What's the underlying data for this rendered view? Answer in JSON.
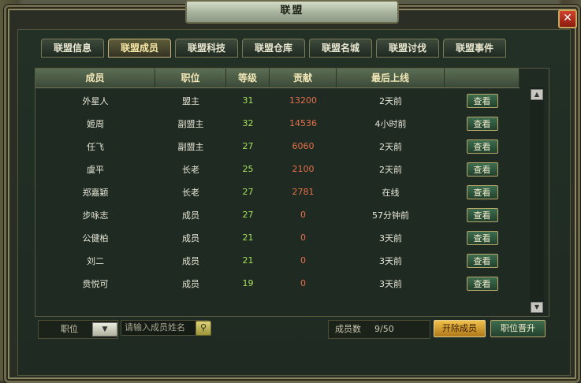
{
  "window": {
    "title": "联盟",
    "close_label": "✕"
  },
  "tabs": [
    {
      "label": "联盟信息",
      "active": false
    },
    {
      "label": "联盟成员",
      "active": true
    },
    {
      "label": "联盟科技",
      "active": false
    },
    {
      "label": "联盟仓库",
      "active": false
    },
    {
      "label": "联盟名城",
      "active": false
    },
    {
      "label": "联盟讨伐",
      "active": false
    },
    {
      "label": "联盟事件",
      "active": false
    }
  ],
  "table": {
    "headers": [
      "成员",
      "职位",
      "等级",
      "贡献",
      "最后上线",
      ""
    ],
    "view_label": "查看",
    "rows": [
      {
        "name": "外星人",
        "position": "盟主",
        "level": "31",
        "contribution": "13200",
        "last_online": "2天前"
      },
      {
        "name": "姬周",
        "position": "副盟主",
        "level": "32",
        "contribution": "14536",
        "last_online": "4小时前"
      },
      {
        "name": "任飞",
        "position": "副盟主",
        "level": "27",
        "contribution": "6060",
        "last_online": "2天前"
      },
      {
        "name": "虞平",
        "position": "长老",
        "level": "25",
        "contribution": "2100",
        "last_online": "2天前"
      },
      {
        "name": "郑嘉颖",
        "position": "长老",
        "level": "27",
        "contribution": "2781",
        "last_online": "在线"
      },
      {
        "name": "步咏志",
        "position": "成员",
        "level": "27",
        "contribution": "0",
        "last_online": "57分钟前"
      },
      {
        "name": "公健柏",
        "position": "成员",
        "level": "21",
        "contribution": "0",
        "last_online": "3天前"
      },
      {
        "name": "刘二",
        "position": "成员",
        "level": "21",
        "contribution": "0",
        "last_online": "3天前"
      },
      {
        "name": "贲悦可",
        "position": "成员",
        "level": "19",
        "contribution": "0",
        "last_online": "3天前"
      }
    ]
  },
  "bottom": {
    "position_filter_label": "职位",
    "search_placeholder": "请输入成员姓名",
    "member_count_label": "成员数",
    "member_count_value": "9/50",
    "kick_label": "开除成员",
    "promote_label": "职位晋升"
  },
  "colors": {
    "level": "#a6e05a",
    "contribution": "#e6704a",
    "active_tab_text": "#f7e6a6"
  },
  "icons": {
    "search": "search-icon",
    "dropdown": "chevron-down-icon",
    "scroll_up": "scroll-up-arrow-icon",
    "scroll_down": "scroll-down-arrow-icon",
    "close": "close-icon"
  }
}
